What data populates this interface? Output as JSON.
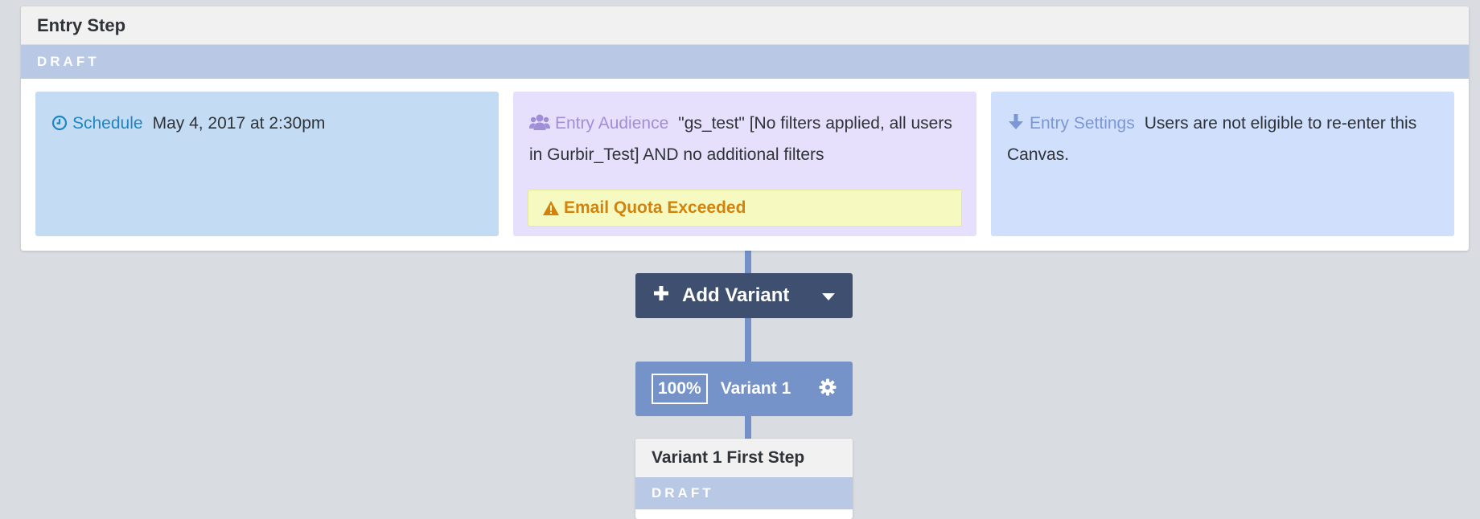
{
  "entry_step": {
    "title": "Entry Step",
    "status": "DRAFT",
    "schedule": {
      "label": "Schedule",
      "value": "May 4, 2017 at 2:30pm",
      "icon": "clock-icon"
    },
    "audience": {
      "label": "Entry Audience",
      "value": "\"gs_test\" [No filters applied, all users in Gurbir_Test] AND no additional filters",
      "icon": "users-icon",
      "warning": "Email Quota Exceeded"
    },
    "settings": {
      "label": "Entry Settings",
      "value": "Users are not eligible to re-enter this Canvas.",
      "icon": "arrow-down-icon"
    }
  },
  "add_variant": {
    "label": "Add Variant"
  },
  "variant": {
    "percent": "100%",
    "name": "Variant 1"
  },
  "first_step": {
    "title": "Variant 1 First Step",
    "status": "DRAFT"
  },
  "colors": {
    "background": "#d9dce0",
    "connector": "#7391c8",
    "draft_band": "#b9c8e4",
    "schedule_panel": "#c4dcf3",
    "audience_panel": "#e6e0fd",
    "settings_panel": "#cfdffc",
    "warning_bg": "#f7fac0",
    "warning_text": "#d2830d",
    "add_variant_button": "#3e4f6f",
    "variant_bar": "#7592c9"
  }
}
